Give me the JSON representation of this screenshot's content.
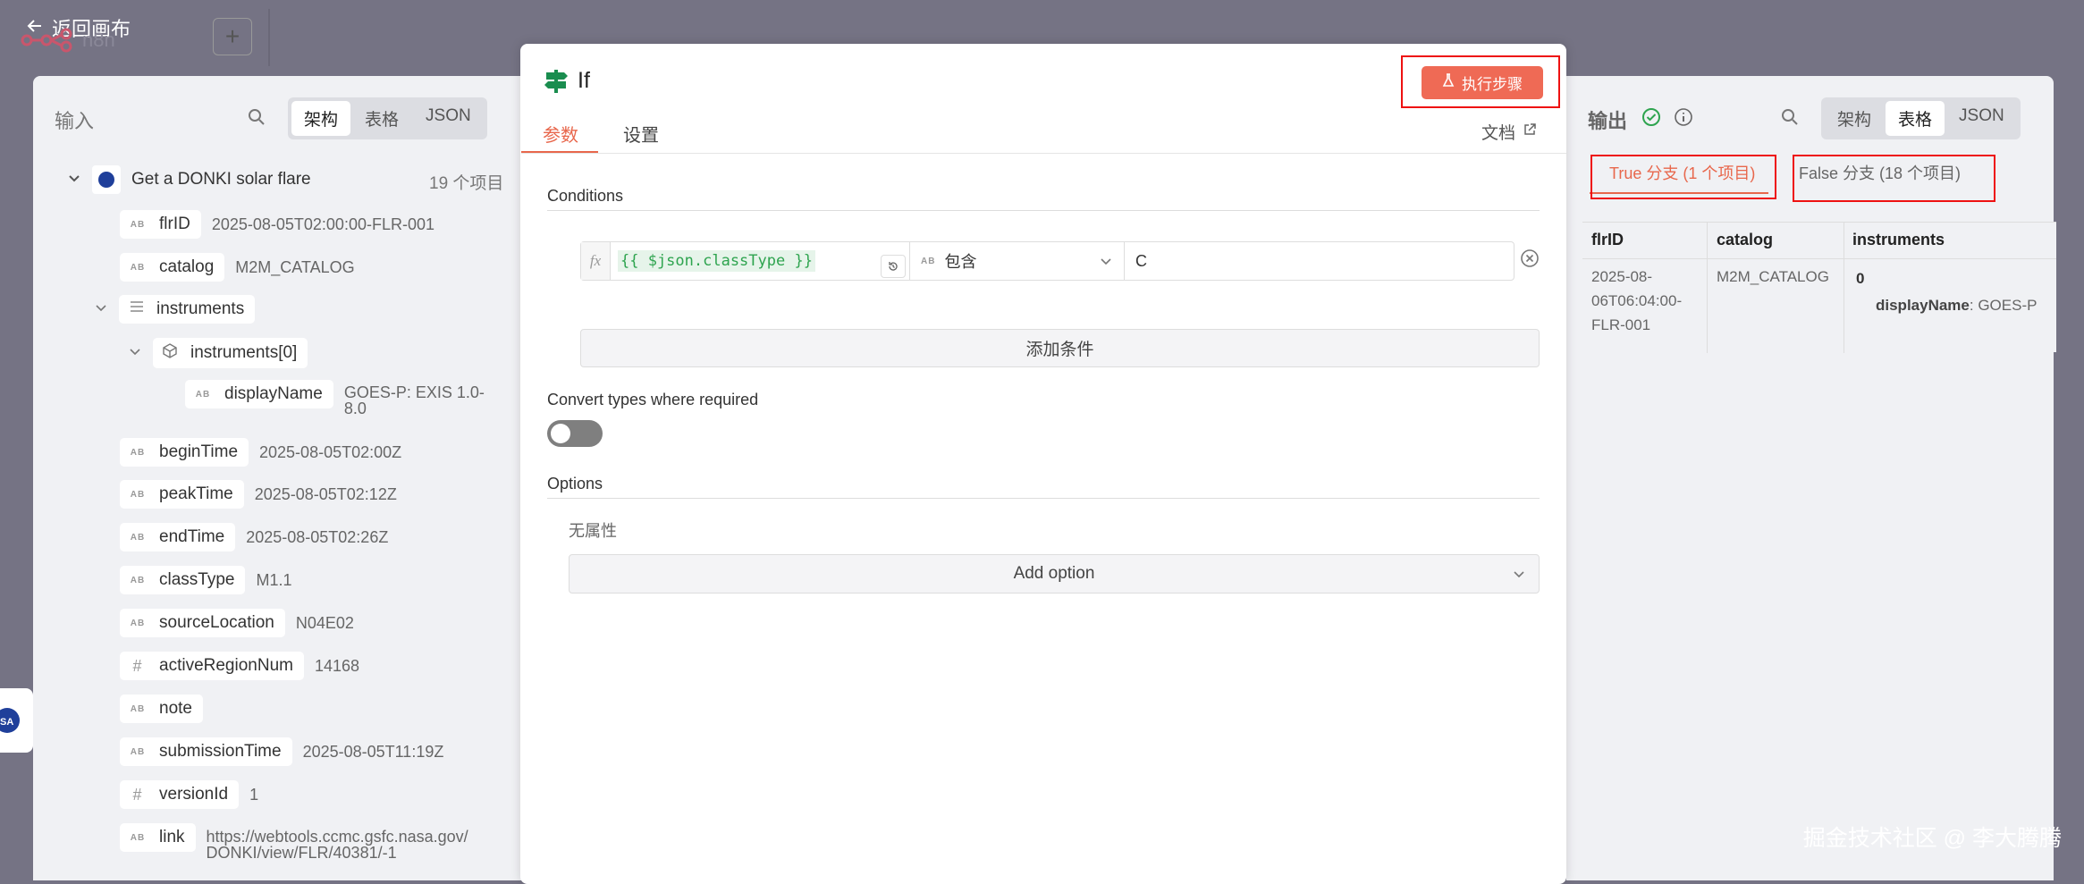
{
  "topbar": {
    "back_label": "返回画布",
    "plus": "+",
    "app_name": "n8n"
  },
  "input": {
    "label": "输入",
    "views": [
      "架构",
      "表格",
      "JSON"
    ],
    "active_view": "架构",
    "node": {
      "name": "Get a DONKI solar flare",
      "count": "19 个项目"
    },
    "fields": [
      {
        "key": "flrID",
        "value": "2025-08-05T02:00:00-FLR-001"
      },
      {
        "key": "catalog",
        "value": "M2M_CATALOG"
      },
      {
        "key": "instruments",
        "value": ""
      },
      {
        "key": "instruments[0]",
        "value": ""
      },
      {
        "key": "displayName",
        "value": "GOES-P: EXIS 1.0-8.0"
      },
      {
        "key": "beginTime",
        "value": "2025-08-05T02:00Z"
      },
      {
        "key": "peakTime",
        "value": "2025-08-05T02:12Z"
      },
      {
        "key": "endTime",
        "value": "2025-08-05T02:26Z"
      },
      {
        "key": "classType",
        "value": "M1.1"
      },
      {
        "key": "sourceLocation",
        "value": "N04E02"
      },
      {
        "key": "activeRegionNum",
        "value": "14168"
      },
      {
        "key": "note",
        "value": ""
      },
      {
        "key": "submissionTime",
        "value": "2025-08-05T11:19Z"
      },
      {
        "key": "versionId",
        "value": "1"
      },
      {
        "key": "link",
        "value": "https://webtools.ccmc.gsfc.nasa.gov/DONKI/view/FLR/40381/-1"
      }
    ],
    "display_name_line1": "GOES-P: EXIS 1.0-",
    "display_name_line2": "8.0",
    "link_line1": "https://webtools.ccmc.gsfc.nasa.gov/",
    "link_line2": "DONKI/view/FLR/40381/-1"
  },
  "node_editor": {
    "title": "If",
    "exec_button": "执行步骤",
    "tabs": [
      "参数",
      "设置"
    ],
    "docs": "文档",
    "conditions_title": "Conditions",
    "condition": {
      "left": "{{ $json.classType }}",
      "operator": "包含",
      "right": "C"
    },
    "add_condition": "添加条件",
    "convert_label": "Convert types where required",
    "convert_enabled": false,
    "options_title": "Options",
    "no_props": "无属性",
    "add_option": "Add option"
  },
  "output": {
    "label": "输出",
    "views": [
      "架构",
      "表格",
      "JSON"
    ],
    "active_view": "表格",
    "branch_true": "True 分支 (1 个项目)",
    "branch_false": "False 分支 (18 个项目)",
    "columns": [
      "flrID",
      "catalog",
      "instruments"
    ],
    "row": {
      "flrID_l1": "2025-08-",
      "flrID_l2": "06T06:04:00-",
      "flrID_l3": "FLR-001",
      "catalog": "M2M_CATALOG",
      "instruments_index": "0",
      "instruments_key": "displayName",
      "instruments_val": ": GOES-P"
    }
  },
  "watermark": "掘金技术社区 @ 李大腾腾",
  "colors": {
    "accent": "#e8674c",
    "exec_bg": "#ef6a55",
    "success": "#2ea44f",
    "code": "#2ea44f"
  }
}
